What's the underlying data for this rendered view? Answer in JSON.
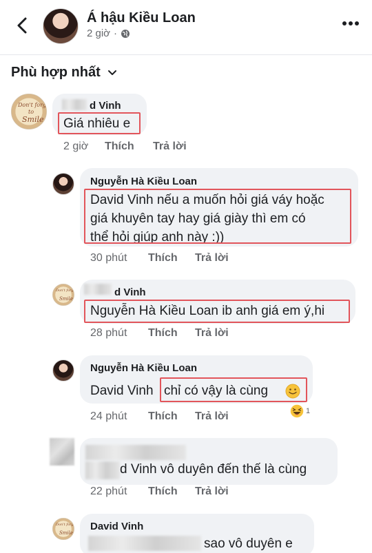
{
  "header": {
    "page_name": "Á hậu Kiều Loan",
    "time": "2 giờ",
    "separator": "·",
    "icons": {
      "back": "chevron-left-icon",
      "privacy": "globe-icon",
      "more": "more-horizontal-icon"
    }
  },
  "sort": {
    "label": "Phù hợp nhất",
    "icon": "chevron-down-icon"
  },
  "actions": {
    "like": "Thích",
    "reply": "Trả lời"
  },
  "avatar_text": {
    "line1": "Don't forget",
    "line2": "to",
    "line3": "Smile"
  },
  "comments": [
    {
      "name": "d Vinh",
      "text": "Giá nhiêu e",
      "time": "2 giờ"
    },
    {
      "name": "Nguyễn Hà Kiều Loan",
      "lines": [
        "David Vinh nếu a muốn hỏi giá váy hoặc",
        "giá khuyên tay hay giá giày thì em có",
        "thể hỏi giúp anh này :))"
      ],
      "time": "30 phút"
    },
    {
      "name": "d Vinh",
      "text": "Nguyễn Hà Kiều Loan ib anh giá em ý,hi",
      "time": "28 phút"
    },
    {
      "name": "Nguyễn Hà Kiều Loan",
      "text_pre": "David Vinh",
      "text_boxed": "chỉ có vậy là cùng",
      "time": "24 phút",
      "reaction": {
        "icon": "haha-emoji-icon",
        "count": "1"
      }
    },
    {
      "name": "",
      "text": "d Vinh vô duyên đến thế là cùng",
      "time": "22 phút"
    },
    {
      "name": "David Vinh",
      "text": "sao vô duyên e"
    }
  ],
  "colors": {
    "highlight_box": "#e2545a",
    "bubble": "#f0f2f5",
    "secondary_text": "#65676b"
  }
}
